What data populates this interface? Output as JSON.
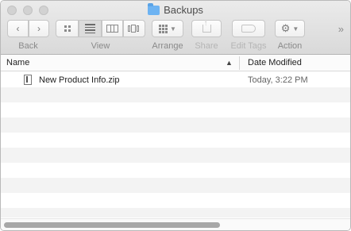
{
  "window": {
    "title": "Backups"
  },
  "toolbar": {
    "back_label": "Back",
    "view_label": "View",
    "arrange_label": "Arrange",
    "share_label": "Share",
    "edit_tags_label": "Edit Tags",
    "action_label": "Action",
    "overflow_glyph": "»"
  },
  "columns": {
    "name": "Name",
    "date_modified": "Date Modified",
    "sort_glyph": "▲"
  },
  "files": [
    {
      "name": "New Product Info.zip",
      "date": "Today, 3:22 PM"
    }
  ],
  "colors": {
    "folder_icon": "#6db3f2",
    "scroll_thumb": "#a8a8a8",
    "row_stripe": "#f3f3f3"
  }
}
